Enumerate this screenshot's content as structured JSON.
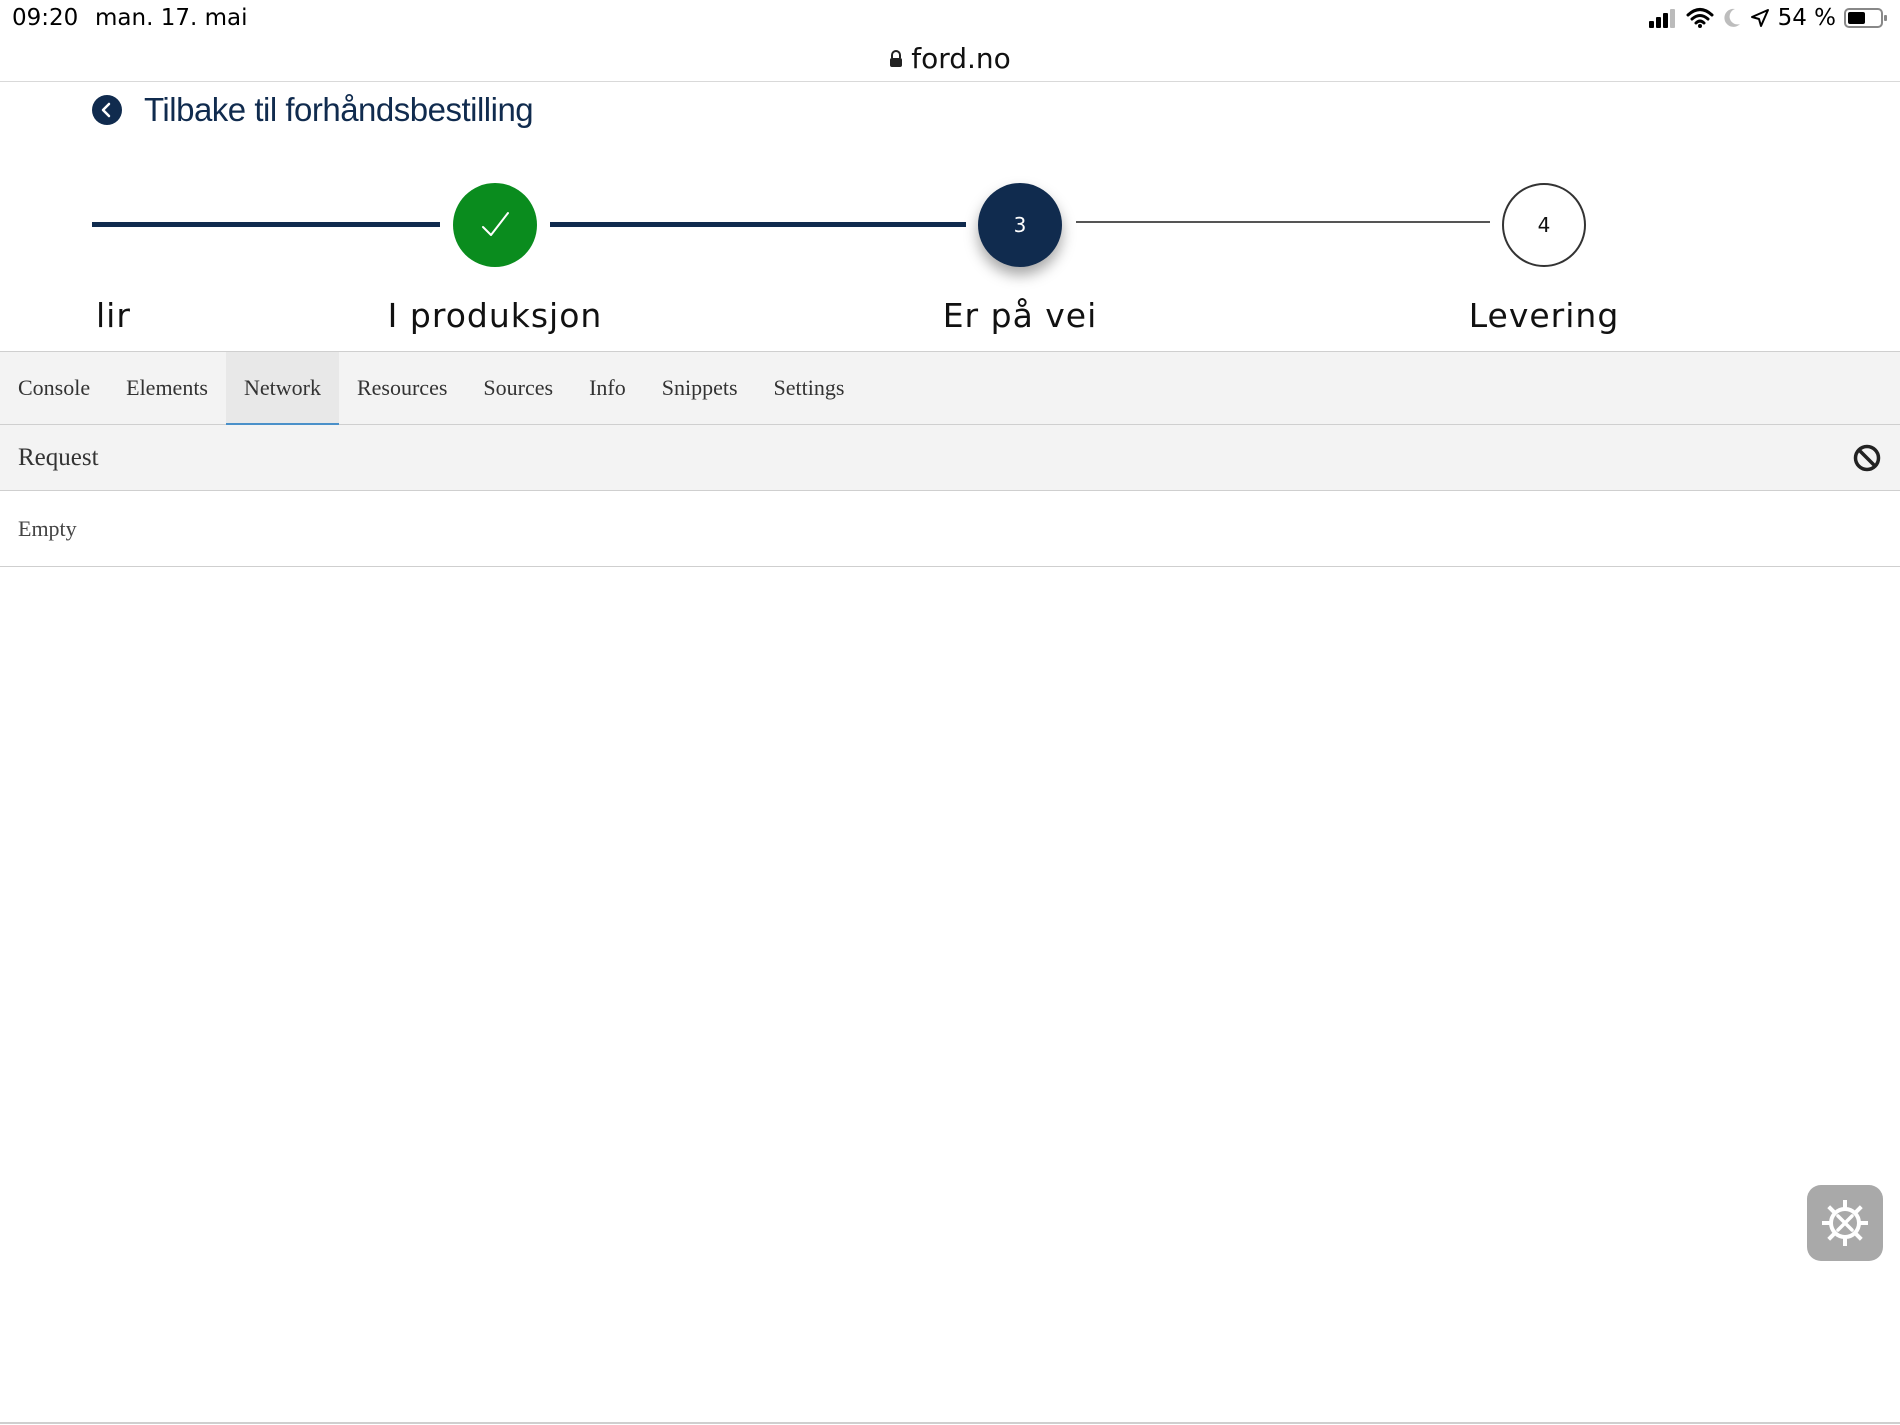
{
  "status_bar": {
    "time": "09:20",
    "date": "man. 17. mai",
    "battery_percent": "54 %",
    "battery_level": 0.54,
    "icons": [
      "signal-icon",
      "wifi-icon",
      "moon-icon",
      "location-arrow-icon",
      "battery-icon"
    ]
  },
  "browser": {
    "url": "ford.no",
    "lock_icon": "lock-icon"
  },
  "page": {
    "back_title": "Tilbake til forhåndsbestilling",
    "back_icon": "chevron-left-icon",
    "colors": {
      "navy": "#102b4e",
      "green": "#0a8c1e"
    },
    "steps": [
      {
        "label": "lir",
        "number": "",
        "state": "completed"
      },
      {
        "label": "I produksjon",
        "number": "",
        "state": "completed",
        "icon": "check-icon"
      },
      {
        "label": "Er på vei",
        "number": "3",
        "state": "current"
      },
      {
        "label": "Levering",
        "number": "4",
        "state": "upcoming"
      }
    ]
  },
  "devtools": {
    "tabs": [
      {
        "label": "Console",
        "active": false
      },
      {
        "label": "Elements",
        "active": false
      },
      {
        "label": "Network",
        "active": true
      },
      {
        "label": "Resources",
        "active": false
      },
      {
        "label": "Sources",
        "active": false
      },
      {
        "label": "Info",
        "active": false
      },
      {
        "label": "Snippets",
        "active": false
      },
      {
        "label": "Settings",
        "active": false
      }
    ],
    "request_header": "Request",
    "clear_icon": "block-icon",
    "empty_text": "Empty",
    "floating_button_icon": "gear-tools-icon",
    "accent": "#4a90c9"
  }
}
